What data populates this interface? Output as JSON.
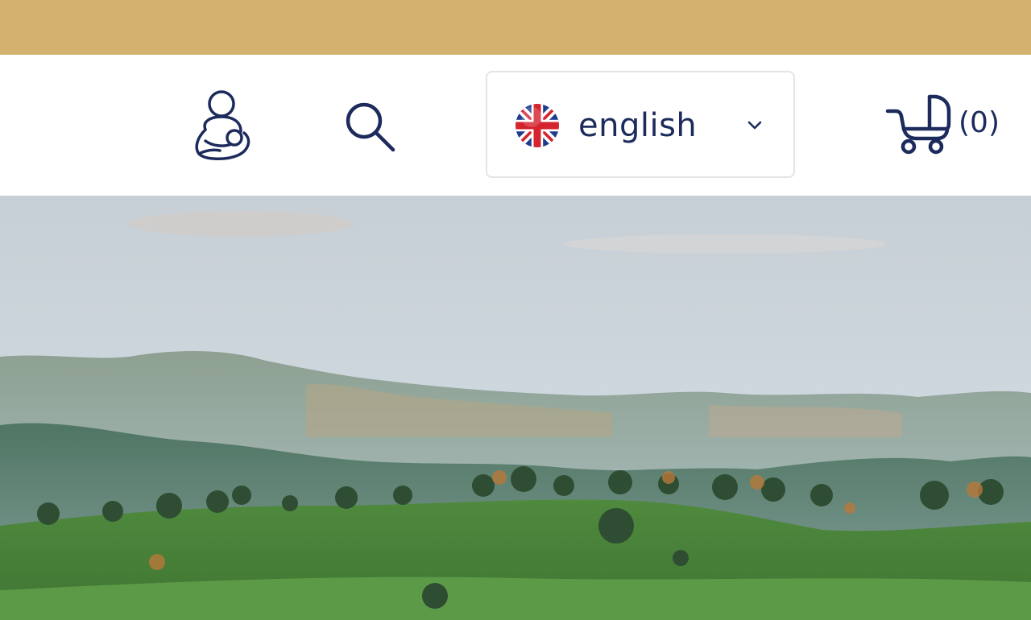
{
  "header": {
    "language": {
      "selected": "english",
      "flag": "uk-flag-icon"
    },
    "cart": {
      "count_label": "(0)"
    },
    "icons": {
      "account": "breastfeeding-mother-icon",
      "search": "search-icon",
      "chevron": "chevron-down-icon",
      "cart": "stroller-icon"
    }
  },
  "colors": {
    "top_bar": "#d3b16f",
    "brand_navy": "#1c2b5c",
    "border": "#e4e4e4"
  }
}
